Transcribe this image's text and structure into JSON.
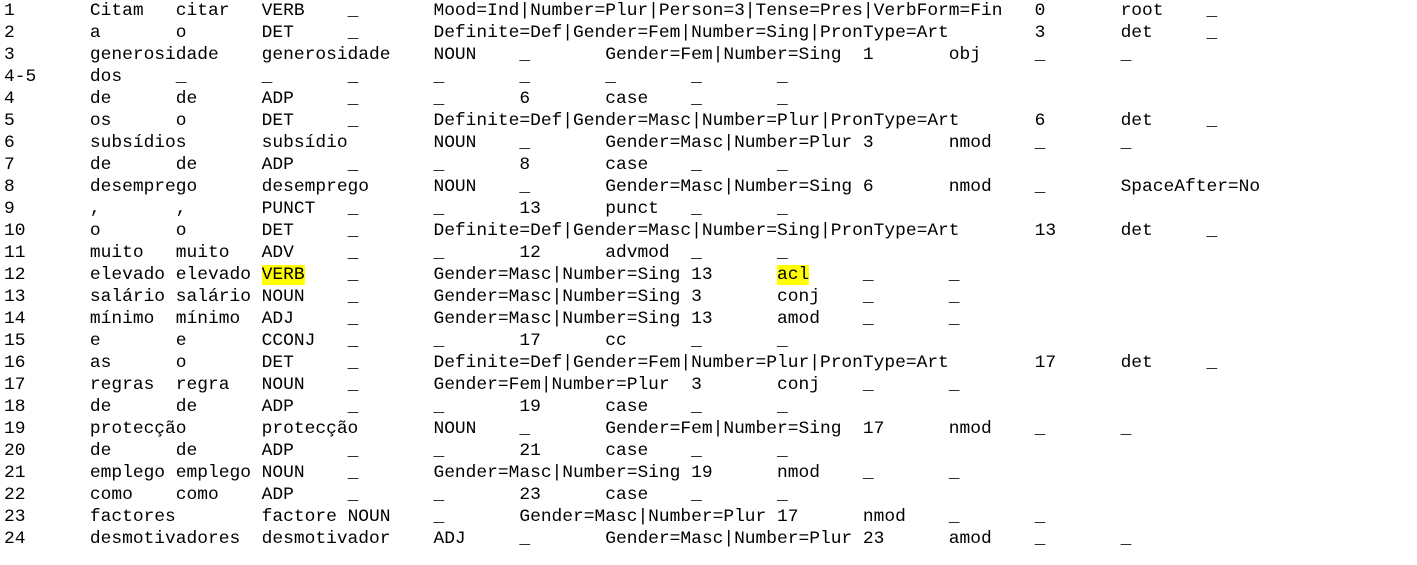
{
  "highlight_color": "#ffff00",
  "lines": [
    "1\tCitam\tcitar\tVERB\t_\tMood=Ind|Number=Plur|Person=3|Tense=Pres|VerbForm=Fin\t0\troot\t_",
    "2\ta\to\tDET\t_\tDefinite=Def|Gender=Fem|Number=Sing|PronType=Art\t3\tdet\t_",
    "3\tgenerosidade\tgenerosidade\tNOUN\t_\tGender=Fem|Number=Sing\t1\tobj\t_\t_",
    "4-5\tdos\t_\t_\t_\t_\t_\t_\t_\t_",
    "4\tde\tde\tADP\t_\t_\t6\tcase\t_\t_",
    "5\tos\to\tDET\t_\tDefinite=Def|Gender=Masc|Number=Plur|PronType=Art\t6\tdet\t_",
    "6\tsubsídios\tsubsídio\tNOUN\t_\tGender=Masc|Number=Plur\t3\tnmod\t_\t_",
    "7\tde\tde\tADP\t_\t_\t8\tcase\t_\t_",
    "8\tdesemprego\tdesemprego\tNOUN\t_\tGender=Masc|Number=Sing\t6\tnmod\t_\tSpaceAfter=No",
    "9\t,\t,\tPUNCT\t_\t_\t13\tpunct\t_\t_",
    "10\to\to\tDET\t_\tDefinite=Def|Gender=Masc|Number=Sing|PronType=Art\t13\tdet\t_",
    "11\tmuito\tmuito\tADV\t_\t_\t12\tadvmod\t_\t_",
    "12\televado\televado\tVERB\t_\tGender=Masc|Number=Sing\t13\tacl\t_\t_",
    "13\tsalário\tsalário\tNOUN\t_\tGender=Masc|Number=Sing\t3\tconj\t_\t_",
    "14\tmínimo\tmínimo\tADJ\t_\tGender=Masc|Number=Sing\t13\tamod\t_\t_",
    "15\te\te\tCCONJ\t_\t_\t17\tcc\t_\t_",
    "16\tas\to\tDET\t_\tDefinite=Def|Gender=Fem|Number=Plur|PronType=Art\t17\tdet\t_",
    "17\tregras\tregra\tNOUN\t_\tGender=Fem|Number=Plur\t3\tconj\t_\t_",
    "18\tde\tde\tADP\t_\t_\t19\tcase\t_\t_",
    "19\tprotecção\tprotecção\tNOUN\t_\tGender=Fem|Number=Sing\t17\tnmod\t_\t_",
    "20\tde\tde\tADP\t_\t_\t21\tcase\t_\t_",
    "21\templego\templego\tNOUN\t_\tGender=Masc|Number=Sing\t19\tnmod\t_\t_",
    "22\tcomo\tcomo\tADP\t_\t_\t23\tcase\t_\t_",
    "23\tfactores\tfactore\tNOUN\t_\tGender=Masc|Number=Plur\t17\tnmod\t_\t_",
    "24\tdesmotivadores\tdesmotivador\tADJ\t_\tGender=Masc|Number=Plur\t23\tamod\t_\t_"
  ],
  "highlights": [
    {
      "line": 12,
      "text": "VERB"
    },
    {
      "line": 12,
      "text": "acl"
    }
  ]
}
